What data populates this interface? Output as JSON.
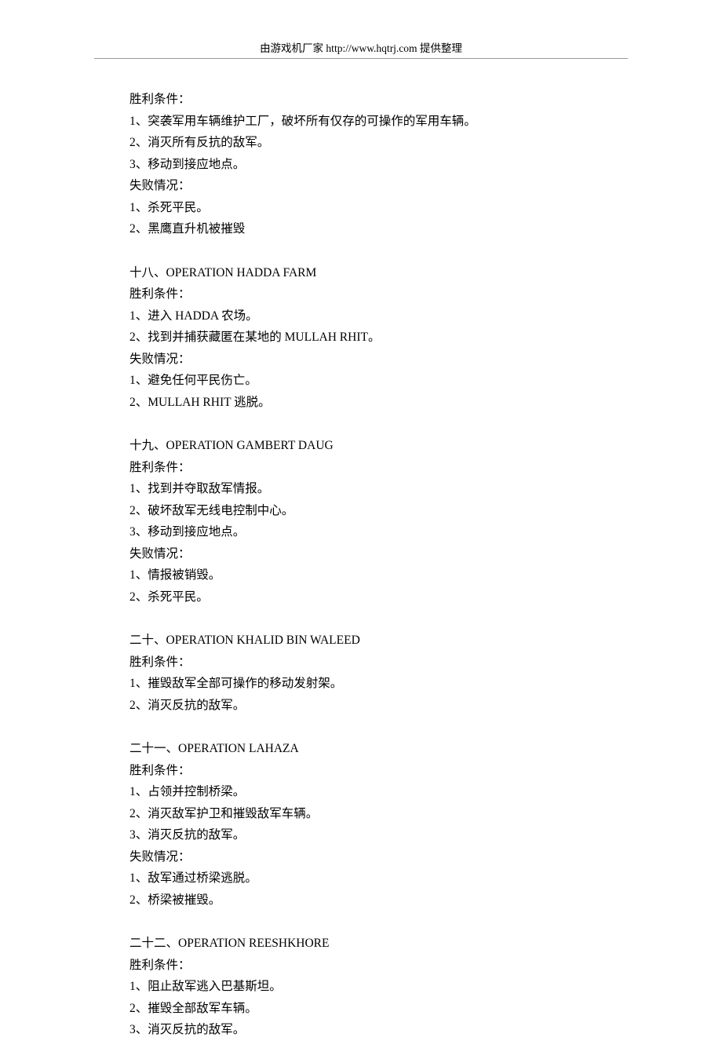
{
  "header": {
    "text": "由游戏机厂家  http://www.hqtrj.com 提供整理"
  },
  "sections": [
    {
      "lines": [
        "胜利条件：",
        "1、突袭军用车辆维护工厂，破坏所有仅存的可操作的军用车辆。",
        "2、消灭所有反抗的敌军。",
        "3、移动到接应地点。",
        "失败情况：",
        "1、杀死平民。",
        "2、黑鹰直升机被摧毁"
      ]
    },
    {
      "lines": [
        "十八、OPERATION   HADDA   FARM",
        "胜利条件：",
        "1、进入 HADDA 农场。",
        "2、找到并捕获藏匿在某地的 MULLAH RHIT。",
        "失败情况：",
        "1、避免任何平民伤亡。",
        "2、MULLAH RHIT 逃脱。"
      ]
    },
    {
      "lines": [
        "十九、OPERATION   GAMBERT   DAUG",
        "胜利条件：",
        "1、找到并夺取敌军情报。",
        "2、破坏敌军无线电控制中心。",
        "3、移动到接应地点。",
        "失败情况：",
        "1、情报被销毁。",
        "2、杀死平民。"
      ]
    },
    {
      "lines": [
        "二十、OPERATION   KHALID   BIN   WALEED",
        "胜利条件：",
        "1、摧毁敌军全部可操作的移动发射架。",
        "2、消灭反抗的敌军。"
      ]
    },
    {
      "lines": [
        "二十一、OPERATION   LAHAZA",
        "胜利条件：",
        "1、占领并控制桥梁。",
        "2、消灭敌军护卫和摧毁敌军车辆。",
        "3、消灭反抗的敌军。",
        "失败情况：",
        "1、敌军通过桥梁逃脱。",
        "2、桥梁被摧毁。"
      ]
    },
    {
      "lines": [
        "二十二、OPERATION   REESHKHORE",
        "胜利条件：",
        "1、阻止敌军逃入巴基斯坦。",
        "2、摧毁全部敌军车辆。",
        "3、消灭反抗的敌军。"
      ]
    }
  ]
}
